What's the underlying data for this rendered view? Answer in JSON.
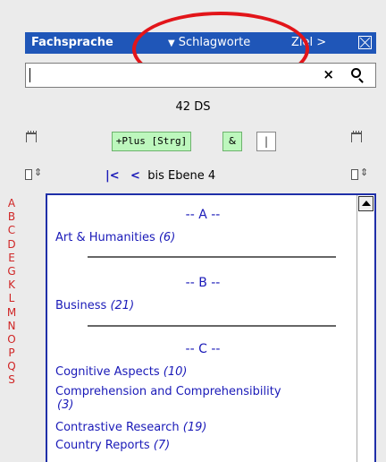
{
  "header": {
    "title": "Fachsprache",
    "dropdown_label": "Schlagworte",
    "target_label": "Ziel >"
  },
  "search": {
    "value": "",
    "clear_glyph": "×",
    "search_icon": "search-icon"
  },
  "record_count": "42 DS",
  "toolbar": {
    "plus_label": "+Plus [Strg]",
    "and_label": "&",
    "or_label": "|"
  },
  "nav": {
    "first": "|<",
    "prev": "<",
    "level_label": "bis Ebene 4"
  },
  "alphabet": [
    "A",
    "B",
    "C",
    "D",
    "E",
    "G",
    "K",
    "L",
    "M",
    "N",
    "O",
    "P",
    "Q",
    "S"
  ],
  "sections": [
    {
      "header": "-- A --",
      "entries": [
        {
          "label": "Art & Humanities",
          "count": "(6)"
        }
      ]
    },
    {
      "header": "-- B --",
      "entries": [
        {
          "label": "Business",
          "count": "(21)"
        }
      ]
    },
    {
      "header": "-- C --",
      "entries": [
        {
          "label": "Cognitive Aspects",
          "count": "(10)"
        },
        {
          "label": "Comprehension and Comprehensibility",
          "count": "(3)"
        },
        {
          "label": "Contrastive Research",
          "count": "(19)"
        },
        {
          "label": "Country Reports",
          "count": "(7)"
        }
      ]
    }
  ],
  "colors": {
    "header_bg": "#1f56b8",
    "accent_blue": "#1a1ab8",
    "letter_red": "#d02525",
    "button_green": "#bdf7bd",
    "annotation_red": "#e2151a"
  }
}
